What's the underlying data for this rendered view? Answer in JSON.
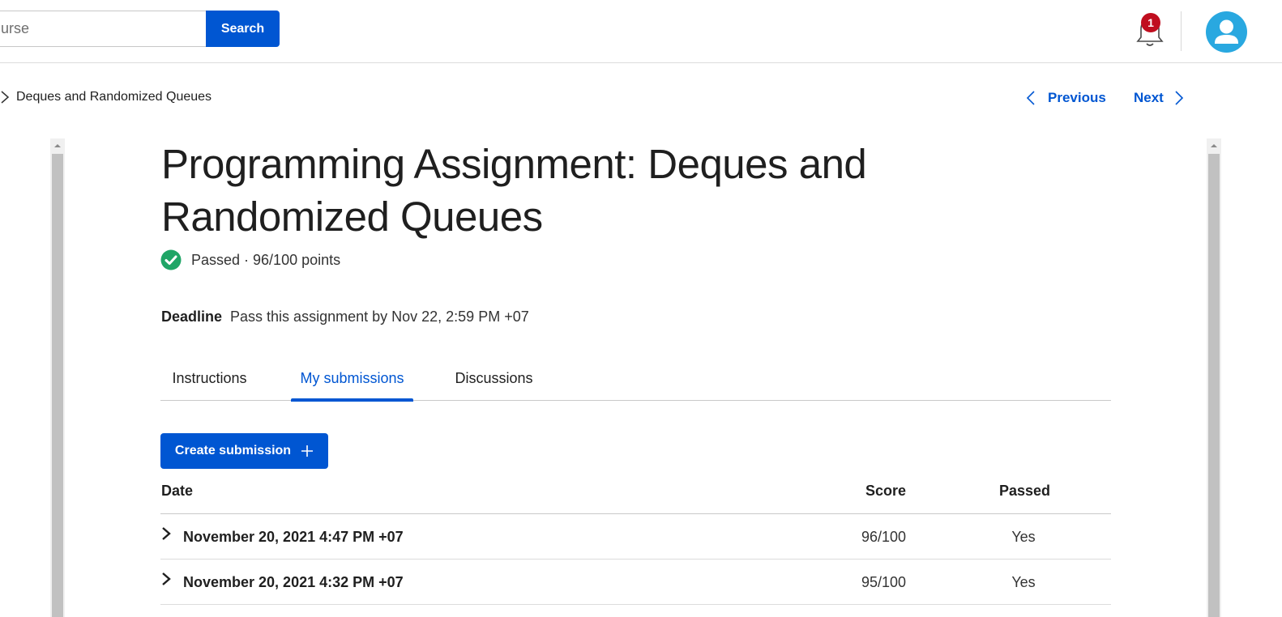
{
  "header": {
    "search_placeholder": "urse",
    "search_button": "Search",
    "notification_count": "1"
  },
  "breadcrumb": {
    "current": "Deques and Randomized Queues"
  },
  "pager": {
    "previous": "Previous",
    "next": "Next"
  },
  "assignment": {
    "title": "Programming Assignment: Deques and Randomized Queues",
    "status": "Passed · 96/100 points",
    "deadline_label": "Deadline",
    "deadline_text": "Pass this assignment by Nov 22, 2:59 PM +07"
  },
  "tabs": [
    {
      "label": "Instructions"
    },
    {
      "label": "My submissions"
    },
    {
      "label": "Discussions"
    }
  ],
  "create_submission": "Create submission",
  "submissions": {
    "columns": {
      "date": "Date",
      "score": "Score",
      "passed": "Passed"
    },
    "rows": [
      {
        "date": "November 20, 2021 4:47 PM +07",
        "score": "96/100",
        "passed": "Yes"
      },
      {
        "date": "November 20, 2021 4:32 PM +07",
        "score": "95/100",
        "passed": "Yes"
      }
    ]
  },
  "colors": {
    "primary": "#0056d2",
    "success": "#1fa566",
    "badge": "#c00e1f",
    "avatar": "#29a8e0"
  }
}
